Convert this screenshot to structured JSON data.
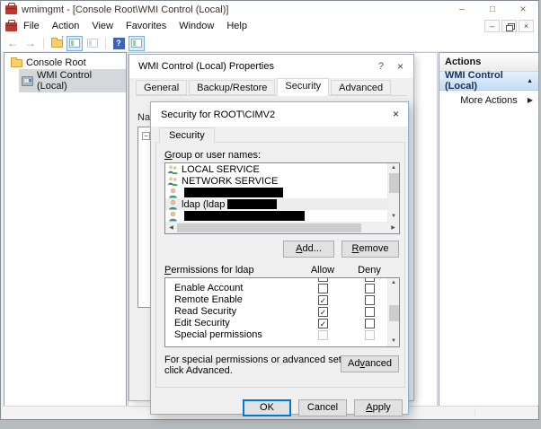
{
  "icons": {
    "close": "×",
    "minimize": "–",
    "maximize": "□",
    "question": "?",
    "back": "←",
    "forward": "→",
    "arrow_up": "↑",
    "help": "?",
    "collapse": "▲",
    "expand": "▶",
    "expander": "−",
    "scroll_up": "▲",
    "scroll_down": "▼",
    "scroll_left": "◀",
    "scroll_right": "▶",
    "check": "✓"
  },
  "window": {
    "title": "wmimgmt - [Console Root\\WMI Control (Local)]",
    "menu": [
      "File",
      "Action",
      "View",
      "Favorites",
      "Window",
      "Help"
    ]
  },
  "tree": {
    "root": "Console Root",
    "item": "WMI Control (Local)"
  },
  "actions": {
    "header": "Actions",
    "group": "WMI Control (Local)",
    "more": "More Actions"
  },
  "props": {
    "title": "WMI Control (Local) Properties",
    "tabs": [
      "General",
      "Backup/Restore",
      "Security",
      "Advanced"
    ],
    "active_tab": "Security",
    "clipped_text": "Na"
  },
  "sec": {
    "title": "Security for ROOT\\CIMV2",
    "tab": "Security",
    "group_label": {
      "m": "G",
      "rest": "roup or user names:"
    },
    "users": [
      {
        "name": "LOCAL SERVICE",
        "redacted": false,
        "selected": false
      },
      {
        "name": "NETWORK SERVICE",
        "redacted": false,
        "selected": false
      },
      {
        "name": "",
        "redacted": true,
        "selected": false
      },
      {
        "name": "ldap (ldap",
        "redacted": true,
        "selected": true
      },
      {
        "name": "",
        "redacted": true,
        "selected": false
      }
    ],
    "add": {
      "m": "A",
      "rest": "dd..."
    },
    "remove": {
      "m": "R",
      "rest": "emove"
    },
    "perm_label": {
      "m": "P",
      "rest": "ermissions for ldap"
    },
    "allow": "Allow",
    "deny": "Deny",
    "permissions": [
      {
        "name": "Enable Account",
        "allow": false,
        "deny": false,
        "disabled": false
      },
      {
        "name": "Remote Enable",
        "allow": true,
        "deny": false,
        "disabled": false
      },
      {
        "name": "Read Security",
        "allow": true,
        "deny": false,
        "disabled": false
      },
      {
        "name": "Edit Security",
        "allow": true,
        "deny": false,
        "disabled": false
      },
      {
        "name": "Special permissions",
        "allow": false,
        "deny": false,
        "disabled": true
      }
    ],
    "note1": "For special permissions or advanced settings,",
    "note2": "click Advanced.",
    "advanced": {
      "pre": "Ad",
      "m": "v",
      "rest": "anced"
    },
    "ok": "OK",
    "cancel": "Cancel",
    "apply": {
      "m": "A",
      "rest": "pply"
    }
  },
  "colors": {
    "accent": "#0078d7",
    "dialog_border": "#85b3dc",
    "redaction": "#000000",
    "selection_gray": "#d4d8db"
  }
}
